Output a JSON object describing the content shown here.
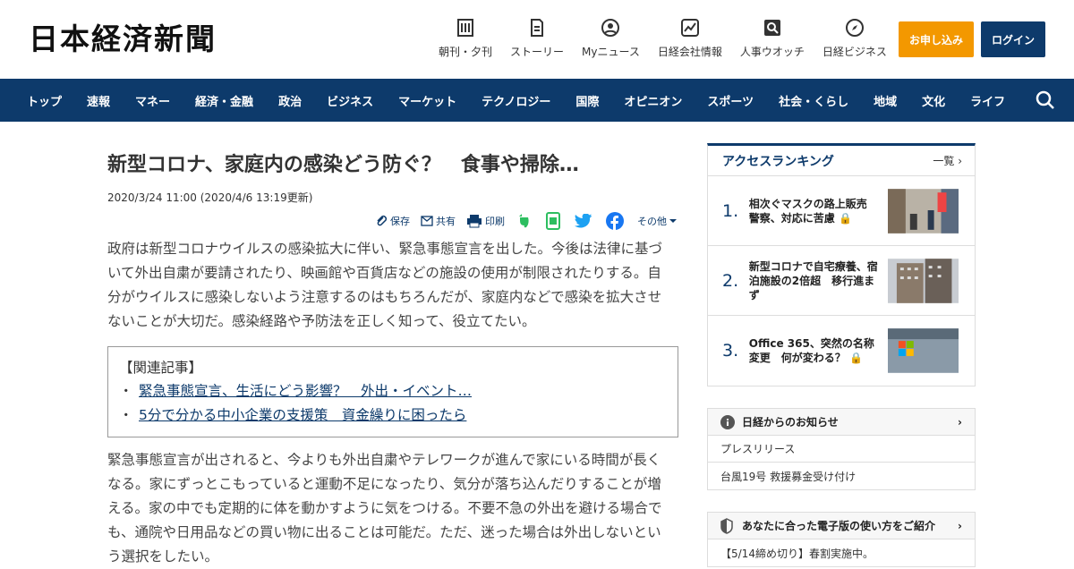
{
  "header": {
    "logo": "日本経済新聞",
    "icons": [
      {
        "label": "朝刊・夕刊",
        "icon": "newspaper-icon"
      },
      {
        "label": "ストーリー",
        "icon": "document-icon"
      },
      {
        "label": "Myニュース",
        "icon": "user-icon"
      },
      {
        "label": "日経会社情報",
        "icon": "chart-icon"
      },
      {
        "label": "人事ウオッチ",
        "icon": "search-person-icon"
      },
      {
        "label": "日経ビジネス",
        "icon": "compass-icon"
      }
    ],
    "apply_label": "お申し込み",
    "login_label": "ログイン"
  },
  "nav": {
    "items": [
      "トップ",
      "速報",
      "マネー",
      "経済・金融",
      "政治",
      "ビジネス",
      "マーケット",
      "テクノロジー",
      "国際",
      "オピニオン",
      "スポーツ",
      "社会・くらし",
      "地域",
      "文化",
      "ライフ"
    ]
  },
  "article": {
    "title": "新型コロナ、家庭内の感染どう防ぐ？　食事や掃除…",
    "date": "2020/3/24 11:00 (2020/4/6 13:19更新)",
    "tools": {
      "save": "保存",
      "share": "共有",
      "print": "印刷",
      "more": "その他"
    },
    "lead": "政府は新型コロナウイルスの感染拡大に伴い、緊急事態宣言を出した。今後は法律に基づいて外出自粛が要請されたり、映画館や百貨店などの施設の使用が制限されたりする。自分がウイルスに感染しないよう注意するのはもちろんだが、家庭内などで感染を拡大させないことが大切だ。感染経路や予防法を正しく知って、役立てたい。",
    "related_heading": "【関連記事】",
    "related": [
      "緊急事態宣言、生活にどう影響？　外出・イベント…",
      "5分で分かる中小企業の支援策　資金繰りに困ったら"
    ],
    "body2": "緊急事態宣言が出されると、今よりも外出自粛やテレワークが進んで家にいる時間が長くなる。家にずっとこもっていると運動不足になったり、気分が落ち込んだりすることが増える。家の中でも定期的に体を動かすように気をつける。不要不急の外出を避ける場合でも、通院や日用品などの買い物に出ることは可能だ。ただ、迷った場合は外出しないという選択をしたい。"
  },
  "sidebar": {
    "ranking_title": "アクセスランキング",
    "ranking_more": "一覧",
    "ranking": [
      {
        "num": "1.",
        "text": "相次ぐマスクの路上販売　警察、対応に苦慮"
      },
      {
        "num": "2.",
        "text": "新型コロナで自宅療養、宿泊施設の2倍超　移行進まず"
      },
      {
        "num": "3.",
        "text": "Office 365、突然の名称変更　何が変わる？"
      }
    ],
    "notice_title": "日経からのお知らせ",
    "notice_items": [
      "プレスリリース",
      "台風19号 救援募金受け付け"
    ],
    "guide_title": "あなたに合った電子版の使い方をご紹介",
    "guide_item": "【5/14締め切り】春割実施中。"
  },
  "colors": {
    "navy": "#0d3a6b",
    "orange": "#f39800"
  }
}
